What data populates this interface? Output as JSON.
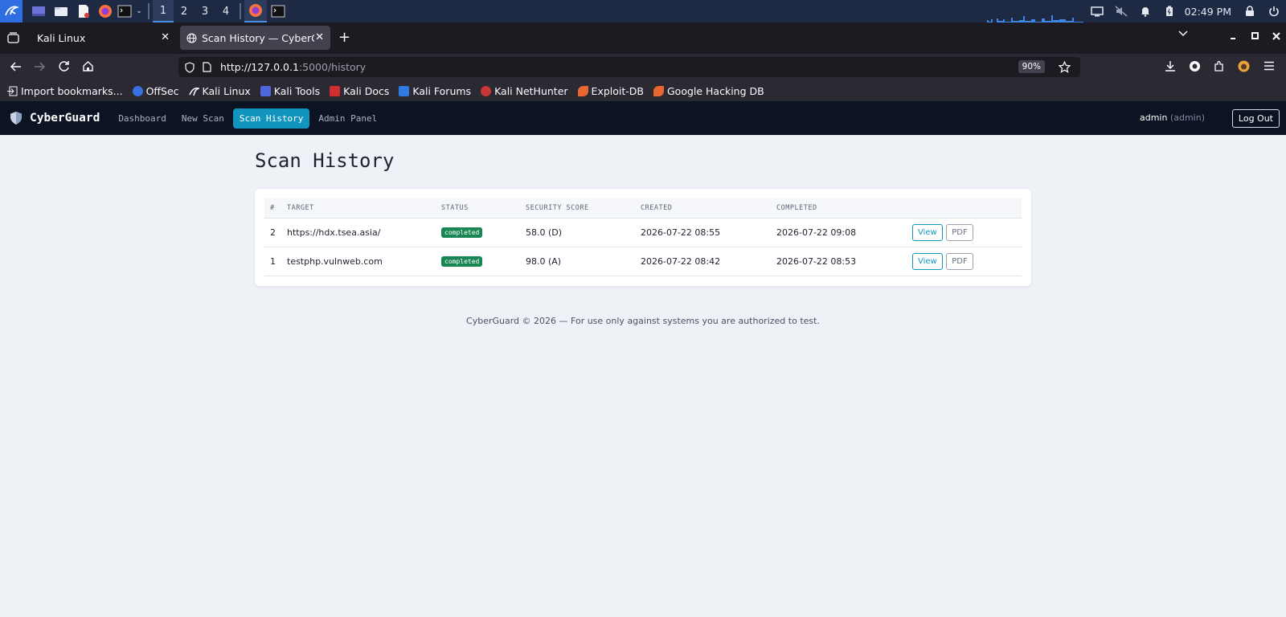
{
  "taskbar": {
    "workspaces": [
      "1",
      "2",
      "3",
      "4"
    ],
    "clock": "02:49 PM"
  },
  "browser": {
    "tabs": [
      {
        "title": "Kali Linux"
      },
      {
        "title": "Scan History — CyberGua"
      }
    ],
    "url": {
      "host": "http://127.0.0.1",
      "path": ":5000/history"
    },
    "zoom": "90%",
    "bookmarks": [
      "Import bookmarks...",
      "OffSec",
      "Kali Linux",
      "Kali Tools",
      "Kali Docs",
      "Kali Forums",
      "Kali NetHunter",
      "Exploit-DB",
      "Google Hacking DB"
    ]
  },
  "app": {
    "brand": "CyberGuard",
    "nav": [
      "Dashboard",
      "New Scan",
      "Scan History",
      "Admin Panel"
    ],
    "user": "admin",
    "role": "(admin)",
    "logout": "Log Out"
  },
  "page": {
    "title": "Scan History",
    "columns": [
      "#",
      "TARGET",
      "STATUS",
      "SECURITY SCORE",
      "CREATED",
      "COMPLETED"
    ],
    "rows": [
      {
        "id": "2",
        "target": "https://hdx.tsea.asia/",
        "status": "completed",
        "score": "58.0 (D)",
        "created": "2026-07-22 08:55",
        "completed": "2026-07-22 09:08",
        "view": "View",
        "pdf": "PDF"
      },
      {
        "id": "1",
        "target": "testphp.vulnweb.com",
        "status": "completed",
        "score": "98.0 (A)",
        "created": "2026-07-22 08:42",
        "completed": "2026-07-22 08:53",
        "view": "View",
        "pdf": "PDF"
      }
    ],
    "footer": "CyberGuard © 2026 — For use only against systems you are authorized to test."
  },
  "colors": {
    "accent": "#1195bf",
    "badge": "#198754",
    "appbar": "#0c1322"
  }
}
